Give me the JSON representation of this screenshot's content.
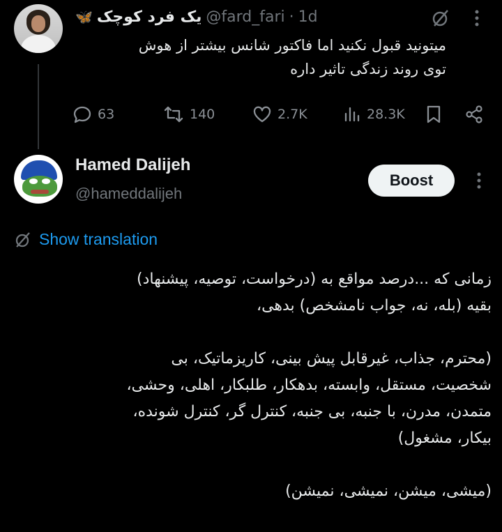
{
  "tweet1": {
    "display_name": "یک فرد کوچک",
    "name_emoji": "🦋",
    "handle": "@fard_fari",
    "separator": "·",
    "time": "1d",
    "text_lines": [
      "میتونید قبول نکنید اما فاکتور شانس بیشتر از هوش",
      "توی روند زندگی تاثیر داره"
    ],
    "actions": {
      "replies": "63",
      "reposts": "140",
      "likes": "2.7K",
      "views": "28.3K"
    }
  },
  "tweet2": {
    "display_name": "Hamed Dalijeh",
    "handle": "@hameddalijeh",
    "boost_label": "Boost",
    "show_translation_label": "Show translation",
    "paragraphs": [
      [
        "زمانی که ...درصد مواقع به (درخواست، توصیه، پیشنهاد)",
        "بقیه (بله، نه، جواب نامشخص) بدهی،"
      ],
      [
        "(محترم، جذاب، غیرقابل پیش بینی، کاریزماتیک، بی",
        "شخصیت، مستقل، وابسته، بدهکار، طلبکار، اهلی، وحشی،",
        "متمدن، مدرن، با جنبه، بی جنبه، کنترل گر، کنترل شونده،",
        "بیکار، مشغول)"
      ],
      [
        "(میشی، میشن، نمیشی، نمیشن)"
      ]
    ]
  },
  "colors": {
    "background": "#000000",
    "text": "#e7e9ea",
    "muted": "#71767b",
    "link": "#1d9bf0",
    "boost_bg": "#eff3f4"
  }
}
